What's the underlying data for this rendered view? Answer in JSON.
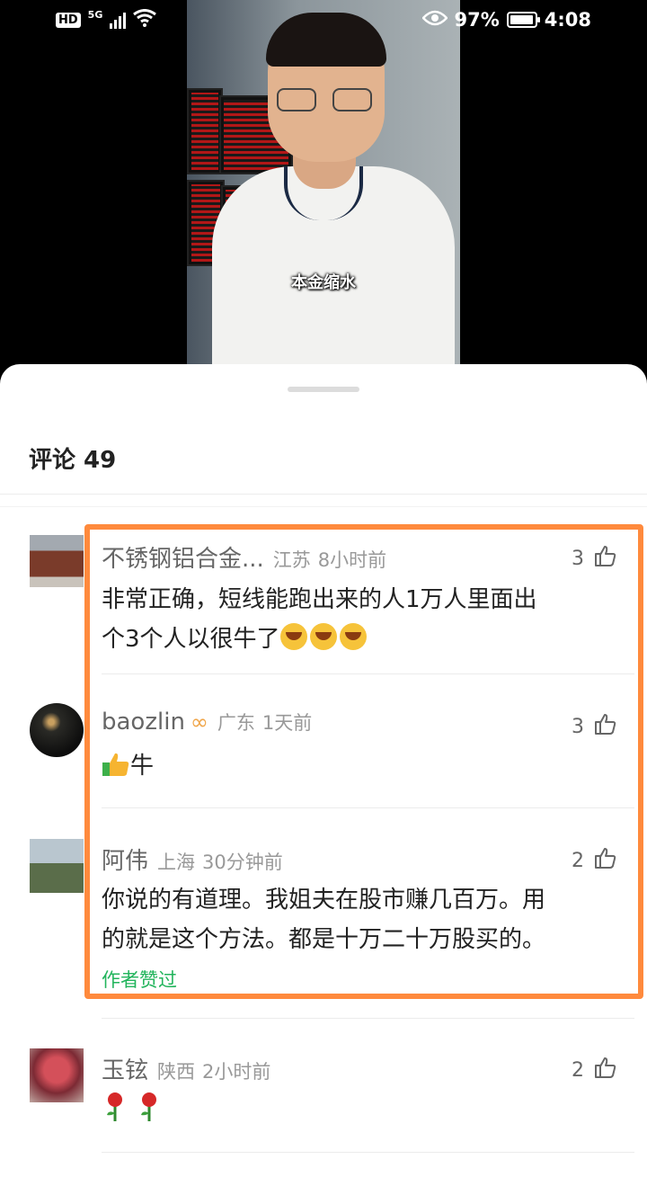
{
  "status_bar": {
    "hd": "HD",
    "network": "5G",
    "battery_percent": "97%",
    "battery_level": 0.97,
    "time": "4:08"
  },
  "video": {
    "subtitle": "本金缩水"
  },
  "comments_panel": {
    "title": "评论 49",
    "comments": [
      {
        "username": "不锈钢铝合金...",
        "location": "江苏",
        "time": "8小时前",
        "likes": "3",
        "text_line1": "非常正确，短线能跑出来的人1万人里面出",
        "text_line2": "个3个人以很牛了"
      },
      {
        "username": "baozlin",
        "badge": "infinity-badge-icon",
        "location": "广东",
        "time": "1天前",
        "likes": "3",
        "text": "牛"
      },
      {
        "username": "阿伟",
        "location": "上海",
        "time": "30分钟前",
        "likes": "2",
        "text_line1": "你说的有道理。我姐夫在股市赚几百万。用",
        "text_line2": "的就是这个方法。都是十万二十万股买的。",
        "author_liked": "作者赞过"
      },
      {
        "username": "玉铉",
        "location": "陕西",
        "time": "2小时前",
        "likes": "2"
      }
    ]
  },
  "colors": {
    "highlight_border": "#ff8a3d",
    "author_liked": "#22b45c",
    "badge": "#f0a64a"
  }
}
